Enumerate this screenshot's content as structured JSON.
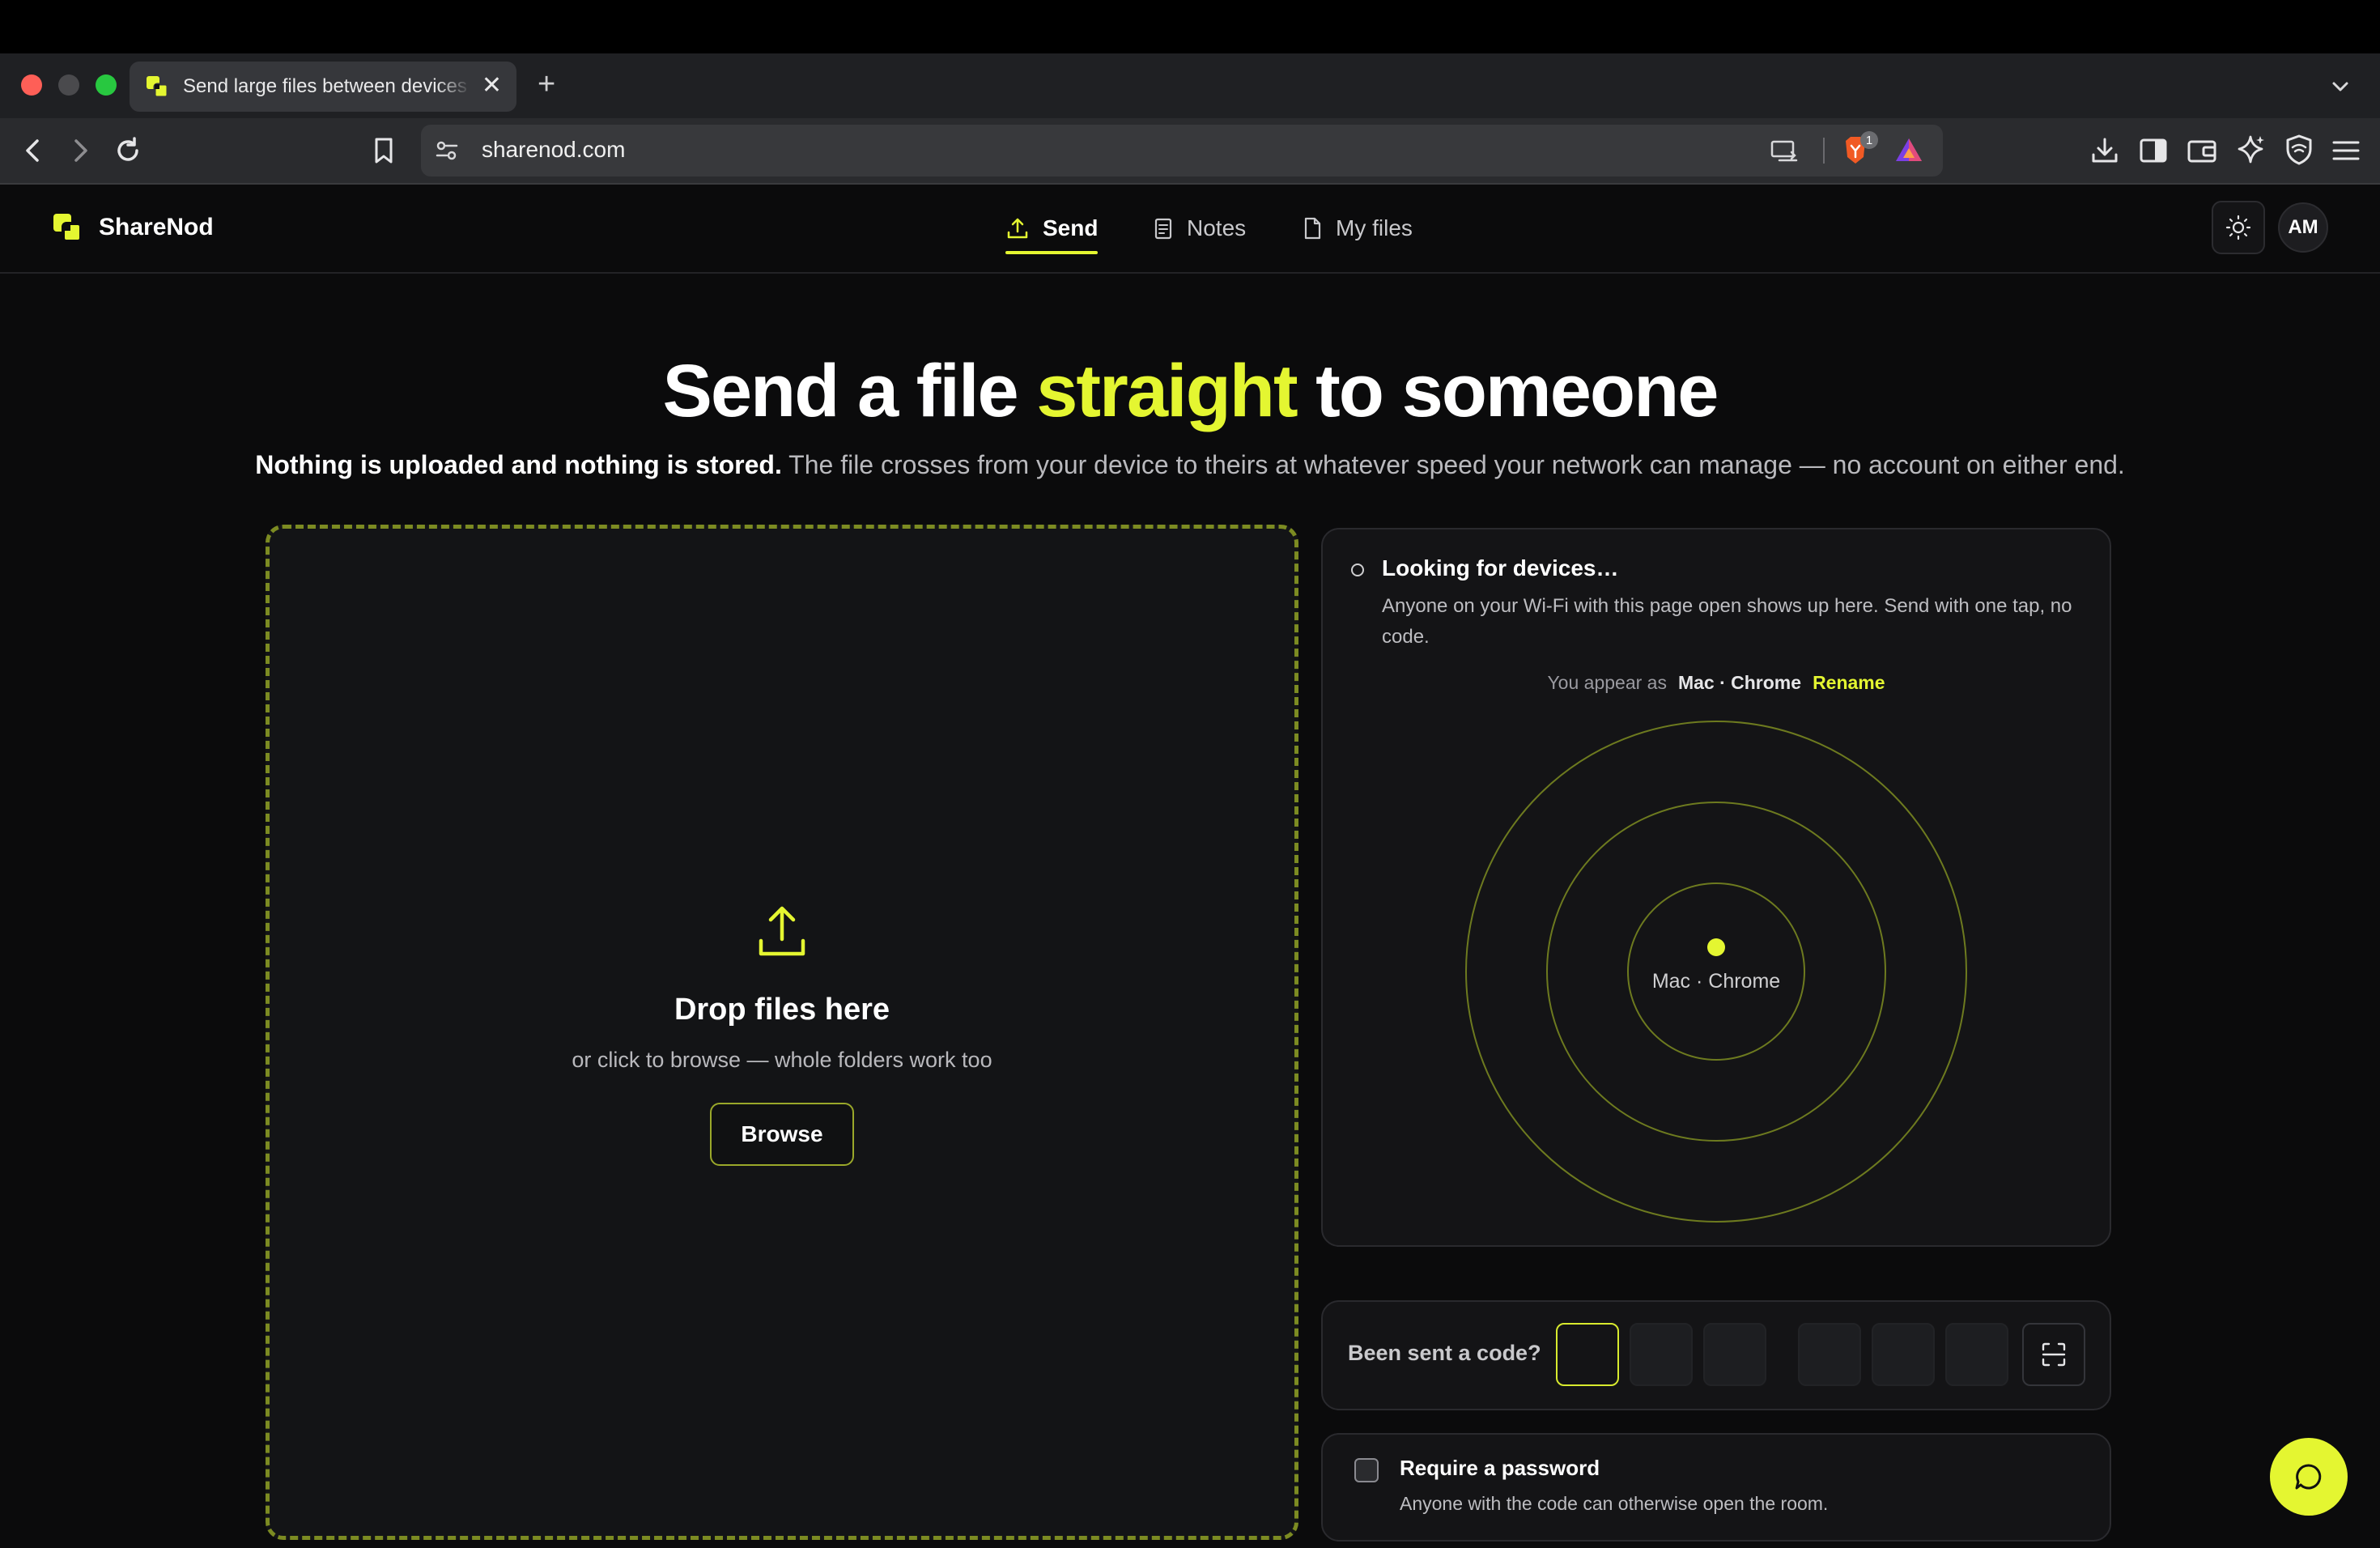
{
  "browser": {
    "tab_title": "Send large files between devices",
    "tab_close": "✕",
    "new_tab": "+",
    "url": "sharenod.com",
    "brave_badge": "1"
  },
  "app": {
    "brand": "ShareNod",
    "nav": {
      "send": "Send",
      "notes": "Notes",
      "my_files": "My files"
    },
    "avatar_initials": "AM"
  },
  "hero": {
    "title_before": "Send a file ",
    "title_highlight": "straight",
    "title_after": " to someone",
    "subtitle_bold": "Nothing is uploaded and nothing is stored.",
    "subtitle_rest": " The file crosses from your device to theirs at whatever speed your network can manage — no account on either end."
  },
  "dropzone": {
    "title": "Drop files here",
    "subtitle": "or click to browse — whole folders work too",
    "browse_label": "Browse"
  },
  "devices": {
    "status_title": "Looking for devices…",
    "description": "Anyone on your Wi-Fi with this page open shows up here. Send with one tap, no code.",
    "appear_as_label": "You appear as",
    "device_name": "Mac · Chrome",
    "rename_label": "Rename",
    "radar_label": "Mac · Chrome"
  },
  "code": {
    "label": "Been sent a code?"
  },
  "password": {
    "title": "Require a password",
    "description": "Anyone with the code can otherwise open the room.",
    "checked": false
  },
  "colors": {
    "accent": "#e4f631",
    "background": "#0b0b0c",
    "panel": "#141416"
  }
}
